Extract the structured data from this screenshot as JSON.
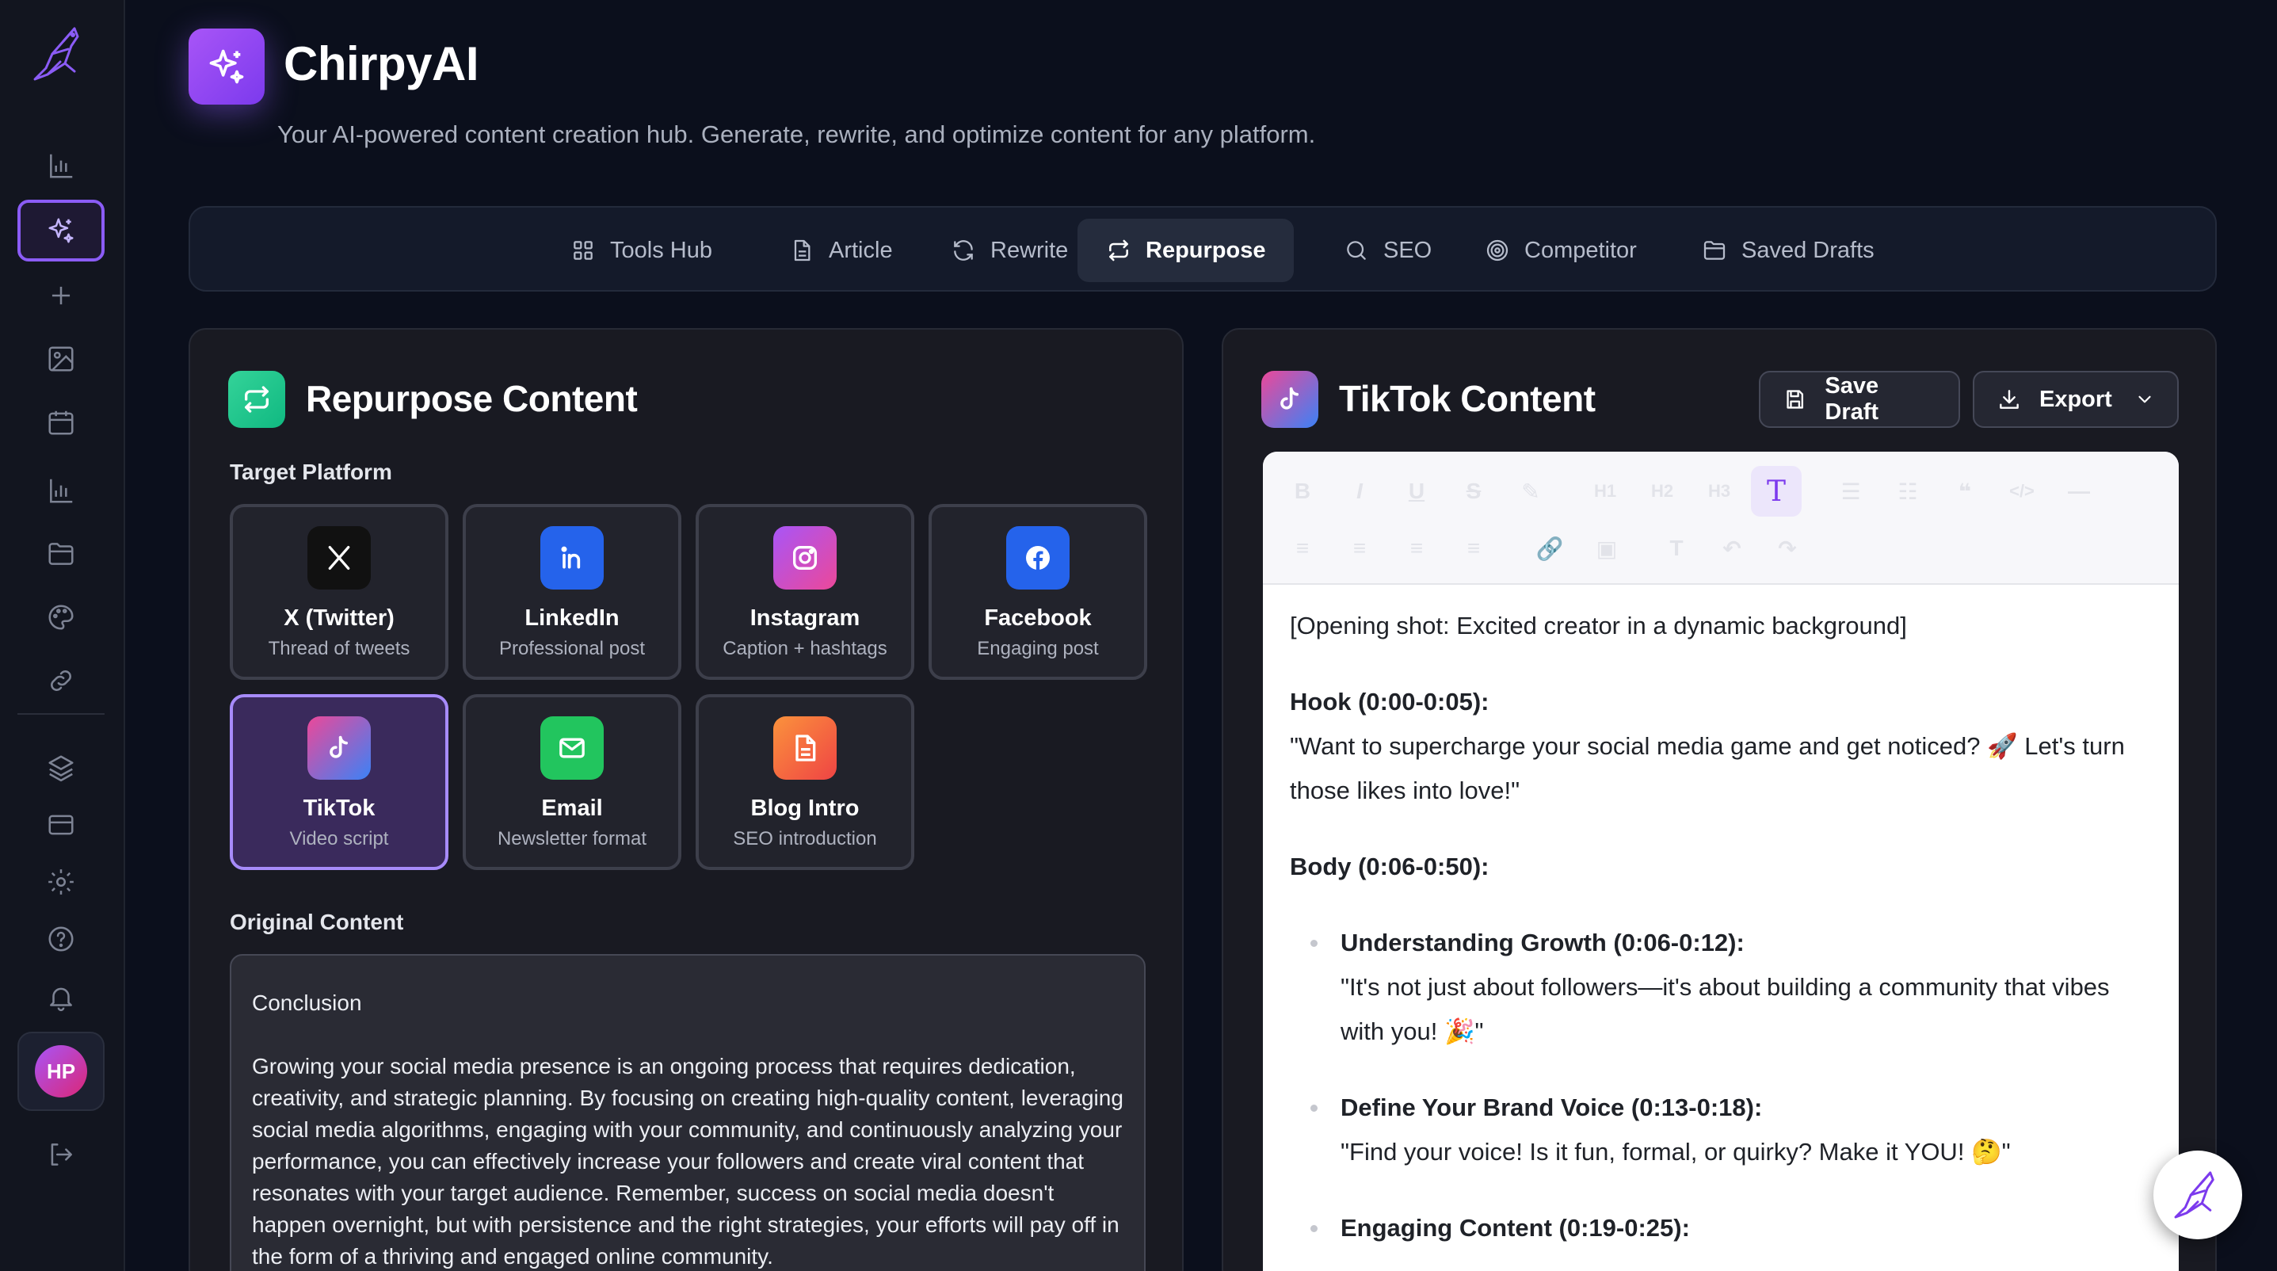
{
  "app": {
    "title": "ChirpyAI",
    "subtitle": "Your AI-powered content creation hub. Generate, rewrite, and optimize content for any platform."
  },
  "sidebar": {
    "user_initials": "HP",
    "items": [
      {
        "icon": "bar-chart-icon"
      },
      {
        "icon": "sparkles-icon",
        "active": true
      },
      {
        "icon": "plus-icon"
      },
      {
        "icon": "image-icon"
      },
      {
        "icon": "calendar-icon"
      },
      {
        "icon": "bar-chart-icon"
      },
      {
        "icon": "folder-icon"
      },
      {
        "icon": "palette-icon"
      },
      {
        "icon": "link-icon"
      },
      {
        "icon": "layers-icon"
      },
      {
        "icon": "credit-card-icon"
      },
      {
        "icon": "settings-icon"
      },
      {
        "icon": "help-icon"
      },
      {
        "icon": "bell-icon"
      },
      {
        "icon": "logout-icon"
      }
    ]
  },
  "tabs": [
    {
      "label": "Tools Hub",
      "icon": "grid-icon"
    },
    {
      "label": "Article",
      "icon": "document-icon"
    },
    {
      "label": "Rewrite",
      "icon": "refresh-icon"
    },
    {
      "label": "Repurpose",
      "icon": "repeat-icon",
      "active": true
    },
    {
      "label": "SEO",
      "icon": "search-icon"
    },
    {
      "label": "Competitor",
      "icon": "target-icon"
    },
    {
      "label": "Saved Drafts",
      "icon": "folder-icon"
    }
  ],
  "repurpose": {
    "title": "Repurpose Content",
    "target_label": "Target Platform",
    "platforms": [
      {
        "name": "X (Twitter)",
        "desc": "Thread of tweets",
        "color": "#111111"
      },
      {
        "name": "LinkedIn",
        "desc": "Professional post",
        "color": "#2563eb"
      },
      {
        "name": "Instagram",
        "desc": "Caption + hashtags",
        "color": "#c026d3"
      },
      {
        "name": "Facebook",
        "desc": "Engaging post",
        "color": "#2563eb"
      },
      {
        "name": "TikTok",
        "desc": "Video script",
        "color": "#ec4899",
        "selected": true
      },
      {
        "name": "Email",
        "desc": "Newsletter format",
        "color": "#22c55e"
      },
      {
        "name": "Blog Intro",
        "desc": "SEO introduction",
        "color": "#f97316"
      }
    ],
    "original_label": "Original Content",
    "original_heading": "Conclusion",
    "original_body": "Growing your social media presence is an ongoing process that requires dedication, creativity, and strategic planning. By focusing on creating high-quality content, leveraging social media algorithms, engaging with your community, and continuously analyzing your performance, you can effectively increase your followers and create viral content that resonates with your target audience. Remember, success on social media doesn't happen overnight, but with persistence and the right strategies, your efforts will pay off in the form of a thriving and engaged online community."
  },
  "output": {
    "title": "TikTok Content",
    "save_label": "Save Draft",
    "export_label": "Export",
    "opening": "[Opening shot: Excited creator in a dynamic background]",
    "hook_title": "Hook (0:00-0:05):",
    "hook_text": "\"Want to supercharge your social media game and get noticed? 🚀 Let's turn those likes into love!\"",
    "body_title": "Body (0:06-0:50):",
    "bullets": [
      {
        "title": "Understanding Growth (0:06-0:12):",
        "text": "\"It's not just about followers—it's about building a community that vibes with you! 🎉\""
      },
      {
        "title": "Define Your Brand Voice (0:13-0:18):",
        "text": "\"Find your voice! Is it fun, formal, or quirky? Make it YOU! 🤔\""
      },
      {
        "title": "Engaging Content (0:19-0:25):",
        "text": ""
      }
    ]
  }
}
